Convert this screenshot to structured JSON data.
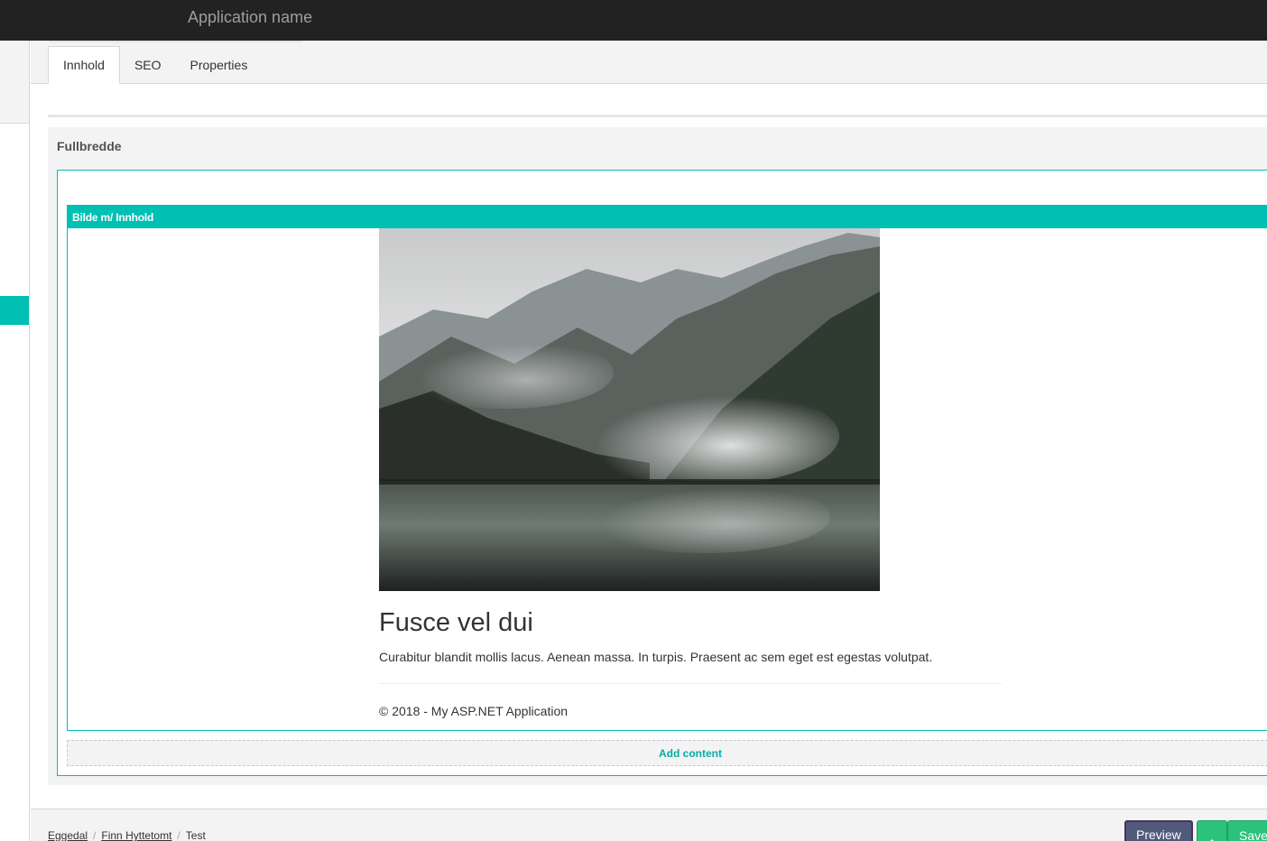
{
  "app": {
    "name": "Application name"
  },
  "tabs": [
    {
      "label": "Innhold",
      "active": true
    },
    {
      "label": "SEO",
      "active": false
    },
    {
      "label": "Properties",
      "active": false
    }
  ],
  "section": {
    "title": "Fullbredde"
  },
  "cell": {
    "header": "Bilde m/ Innhold",
    "image": "misty-mountain-lake-photo",
    "title": "Fusce vel dui",
    "text": "Curabitur blandit mollis lacus. Aenean massa. In turpis. Praesent ac sem eget est egestas volutpat.",
    "footer": "© 2018 - My ASP.NET Application"
  },
  "add_content": {
    "label": "Add content"
  },
  "breadcrumb": [
    "Eggedal",
    "Finn Hyttetomt",
    "Test"
  ],
  "actions": {
    "preview": "Preview",
    "save": "Save"
  },
  "colors": {
    "accent": "#00bfb3",
    "topbar": "#222222",
    "preview": "#515a7a",
    "save": "#2bc37c"
  }
}
